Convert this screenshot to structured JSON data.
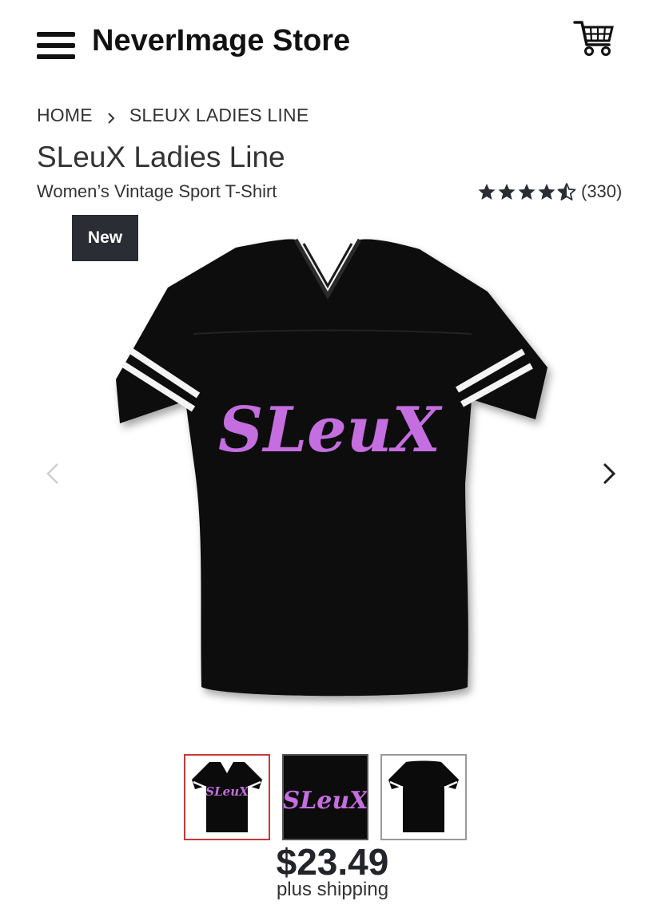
{
  "header": {
    "store_name": "NeverImage Store",
    "menu_icon": "hamburger-menu-icon",
    "cart_icon": "shopping-cart-icon"
  },
  "breadcrumb": {
    "items": [
      "HOME",
      "SLEUX LADIES LINE"
    ],
    "separator_icon": "chevron-right-icon"
  },
  "product": {
    "title": "SLeuX Ladies Line",
    "subtitle": "Women’s Vintage Sport T-Shirt",
    "rating_value": 4.5,
    "rating_max": 5,
    "review_count": "(330)",
    "badge": "New",
    "price": "$23.49",
    "shipping_note": "plus shipping",
    "shirt_print_text": "SLeuX"
  },
  "carousel": {
    "prev_icon": "chevron-left-icon",
    "next_icon": "chevron-right-icon",
    "thumbnails": [
      {
        "view": "front",
        "selected": true
      },
      {
        "view": "design-detail",
        "selected": false
      },
      {
        "view": "back",
        "selected": false
      }
    ]
  },
  "colors": {
    "shirt": "#0b0b0b",
    "print": "#c46ee0",
    "stripe": "#ffffff",
    "badge_bg": "#2a2d33",
    "selected_thumb_border": "#c63a3a"
  }
}
